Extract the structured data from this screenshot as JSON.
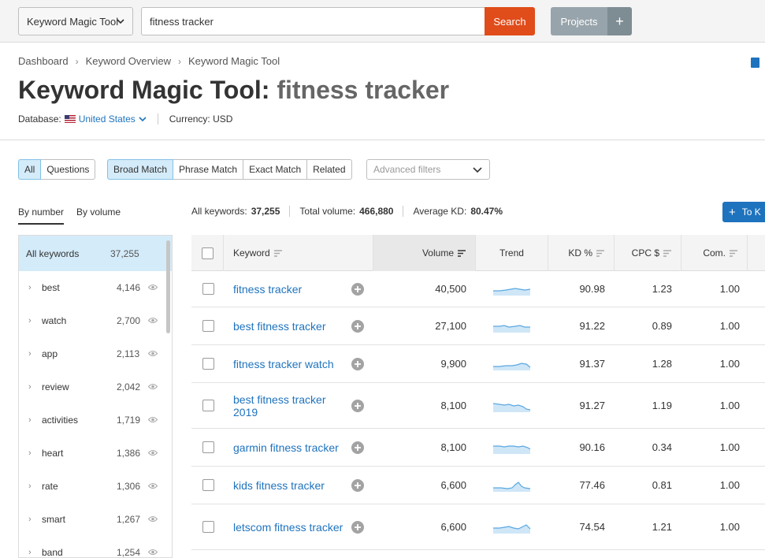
{
  "topbar": {
    "tool_select": "Keyword Magic Tool",
    "search_value": "fitness tracker",
    "search_button": "Search",
    "projects_button": "Projects",
    "plus_label": "+"
  },
  "breadcrumb": [
    "Dashboard",
    "Keyword Overview",
    "Keyword Magic Tool"
  ],
  "title": {
    "prefix": "Keyword Magic Tool:",
    "keyword": "fitness tracker"
  },
  "database": {
    "label": "Database:",
    "value": "United States",
    "currency": "Currency: USD"
  },
  "filters": {
    "group1": [
      "All",
      "Questions"
    ],
    "group2": [
      "Broad Match",
      "Phrase Match",
      "Exact Match",
      "Related"
    ],
    "advanced": "Advanced filters"
  },
  "side": {
    "tabs": [
      "By number",
      "By volume"
    ],
    "all_label": "All keywords",
    "all_count": "37,255",
    "items": [
      {
        "label": "best",
        "count": "4,146"
      },
      {
        "label": "watch",
        "count": "2,700"
      },
      {
        "label": "app",
        "count": "2,113"
      },
      {
        "label": "review",
        "count": "2,042"
      },
      {
        "label": "activities",
        "count": "1,719"
      },
      {
        "label": "heart",
        "count": "1,386"
      },
      {
        "label": "rate",
        "count": "1,306"
      },
      {
        "label": "smart",
        "count": "1,267"
      },
      {
        "label": "band",
        "count": "1,254"
      }
    ]
  },
  "summary": {
    "all_label": "All keywords:",
    "all_value": "37,255",
    "vol_label": "Total volume:",
    "vol_value": "466,880",
    "kd_label": "Average KD:",
    "kd_value": "80.47%",
    "to_button": "To K"
  },
  "table": {
    "headers": {
      "keyword": "Keyword",
      "volume": "Volume",
      "trend": "Trend",
      "kd": "KD %",
      "cpc": "CPC $",
      "com": "Com."
    },
    "rows": [
      {
        "keyword": "fitness tracker",
        "volume": "40,500",
        "kd": "90.98",
        "cpc": "1.23",
        "com": "1.00"
      },
      {
        "keyword": "best fitness tracker",
        "volume": "27,100",
        "kd": "91.22",
        "cpc": "0.89",
        "com": "1.00"
      },
      {
        "keyword": "fitness tracker watch",
        "volume": "9,900",
        "kd": "91.37",
        "cpc": "1.28",
        "com": "1.00"
      },
      {
        "keyword": "best fitness tracker 2019",
        "volume": "8,100",
        "kd": "91.27",
        "cpc": "1.19",
        "com": "1.00"
      },
      {
        "keyword": "garmin fitness tracker",
        "volume": "8,100",
        "kd": "90.16",
        "cpc": "0.34",
        "com": "1.00"
      },
      {
        "keyword": "kids fitness tracker",
        "volume": "6,600",
        "kd": "77.46",
        "cpc": "0.81",
        "com": "1.00"
      },
      {
        "keyword": "letscom fitness tracker",
        "volume": "6,600",
        "kd": "74.54",
        "cpc": "1.21",
        "com": "1.00"
      }
    ]
  },
  "colors": {
    "accent": "#1e73be",
    "search": "#e04c1a",
    "selected": "#d4ebf9"
  }
}
